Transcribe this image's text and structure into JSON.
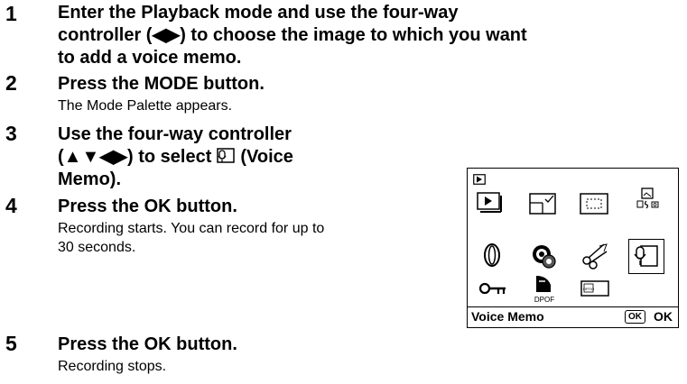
{
  "steps": [
    {
      "number": "1",
      "title_lines": [
        "Enter the Playback mode and use the four-way",
        "controller (◀▶) to choose the image to which you want",
        "to add a voice memo."
      ]
    },
    {
      "number": "2",
      "title": "Press the MODE button.",
      "description": "The Mode Palette appears."
    },
    {
      "number": "3",
      "title_line1": "Use the four-way controller",
      "title_line2": "(▲▼◀▶) to select",
      "title_line2_suffix": "(Voice",
      "title_line3": "Memo)."
    },
    {
      "number": "4",
      "title": "Press the OK button.",
      "description_lines": [
        "Recording starts. You can record for up to",
        "30 seconds."
      ]
    },
    {
      "number": "5",
      "title": "Press the OK button.",
      "description": "Recording stops."
    }
  ],
  "palette": {
    "selected_label": "Voice Memo",
    "ok_key": "OK",
    "ok_label": "OK",
    "icons": [
      "playback-mode-icon",
      "slideshow-icon",
      "resize-icon",
      "trimming-icon",
      "image-copy-icon",
      "rotate-icon",
      "digital-filter-icon",
      "frame-composite-icon",
      "voice-memo-icon",
      "protect-icon",
      "dpof-icon",
      "start-up-screen-icon"
    ],
    "dpof_text": "DPOF",
    "card_text": "OPTIO"
  }
}
